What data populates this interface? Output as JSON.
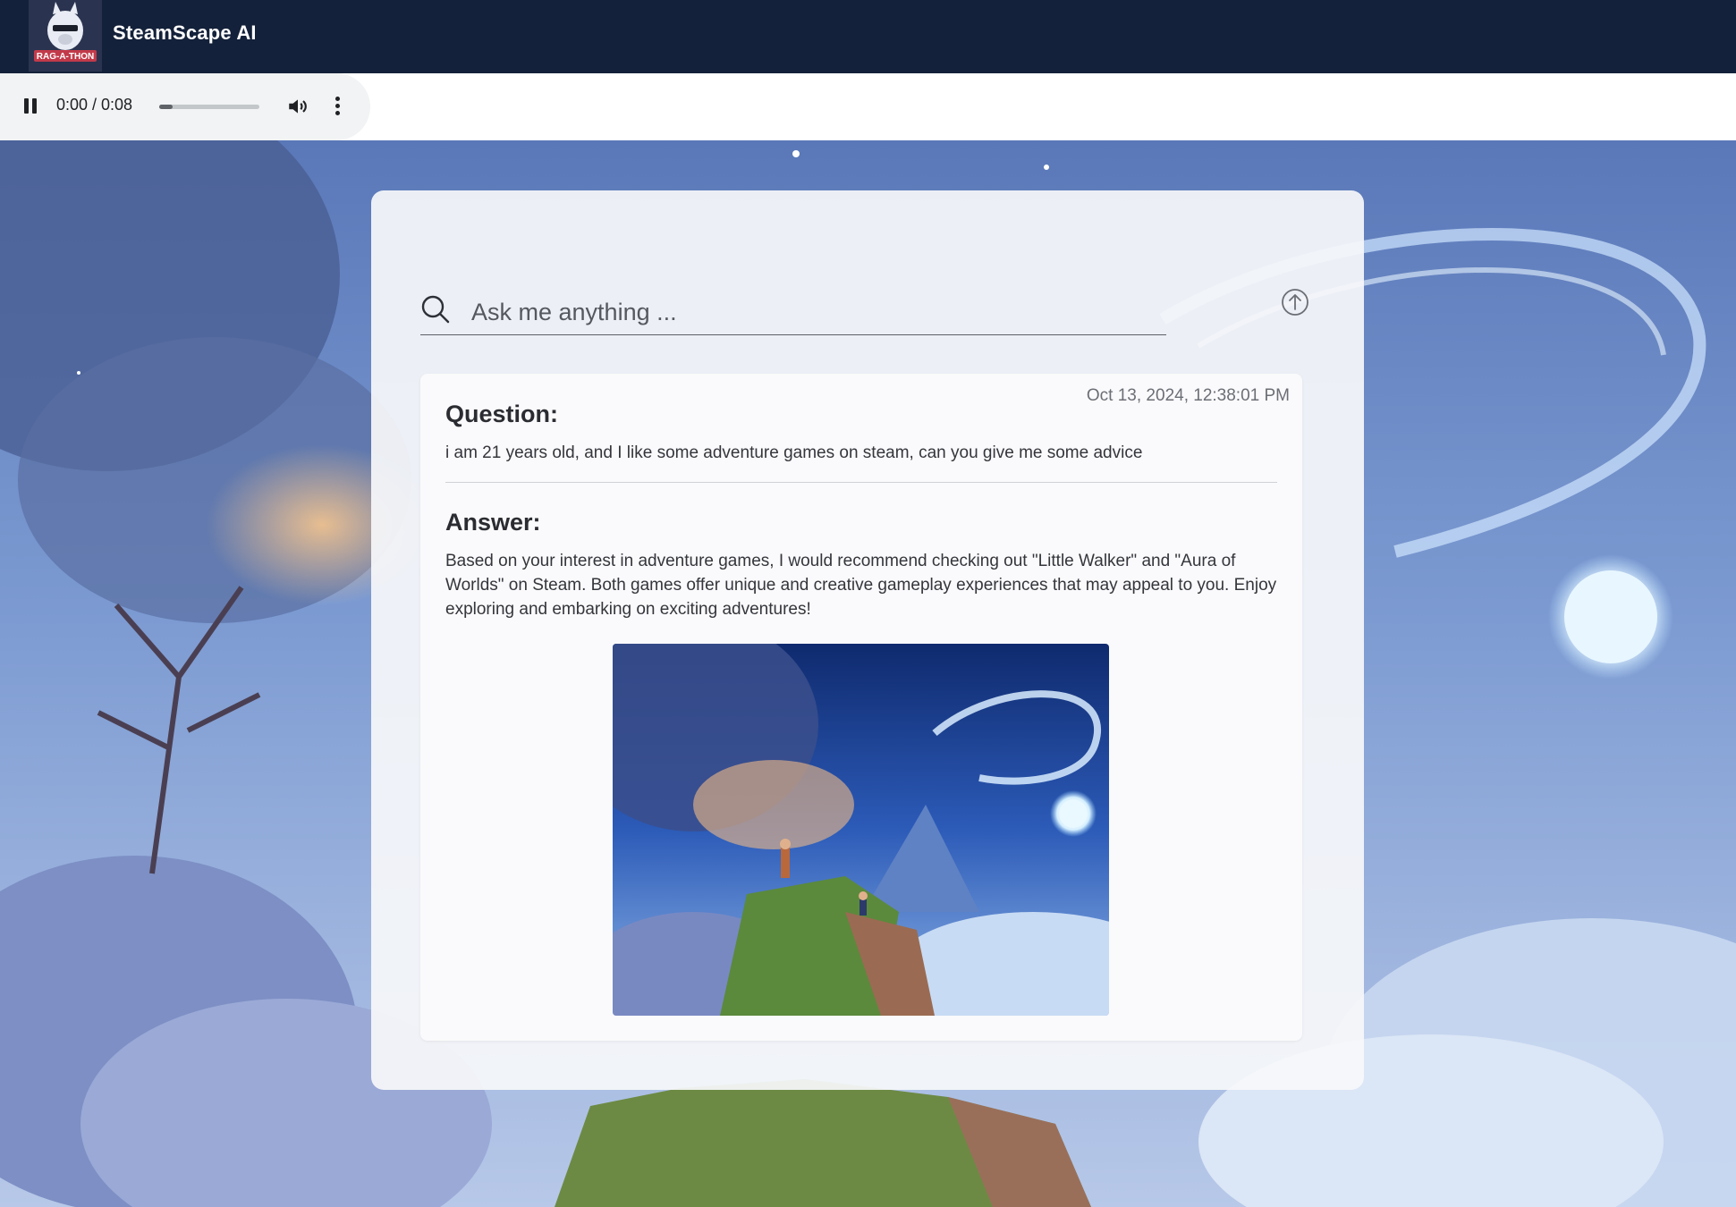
{
  "header": {
    "app_title": "SteamScape AI",
    "logo_text": "RAG-A-THON",
    "background_color": "#14213a"
  },
  "audio": {
    "time_display": "0:00 / 0:08",
    "progress": 0.13,
    "state": "playing",
    "icons": [
      "pause-icon",
      "volume-icon",
      "more-vert-icon"
    ]
  },
  "search": {
    "placeholder": "Ask me anything ...",
    "icon": "search-icon",
    "submit_icon": "arrow-up-circle-icon"
  },
  "result": {
    "timestamp": "Oct 13, 2024, 12:38:01 PM",
    "question_label": "Question:",
    "question_text": "i am 21 years old, and I like some adventure games on steam, can you give me some advice",
    "answer_label": "Answer:",
    "answer_text": "Based on your interest in adventure games, I would recommend checking out \"Little Walker\" and \"Aura of Worlds\" on Steam. Both games offer unique and creative gameplay experiences that may appeal to you. Enjoy exploring and embarking on exciting adventures!"
  }
}
